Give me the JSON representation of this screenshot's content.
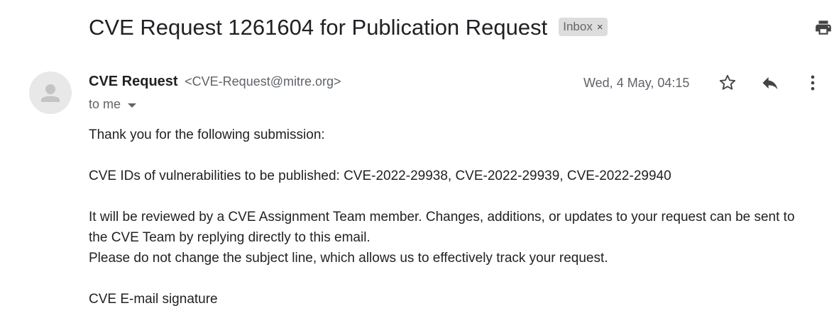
{
  "email": {
    "subject": "CVE Request 1261604 for Publication Request",
    "label": "Inbox",
    "label_close": "×",
    "sender_name": "CVE Request",
    "sender_email": "<CVE-Request@mitre.org>",
    "recipient": "to me",
    "timestamp": "Wed, 4 May, 04:15",
    "body": {
      "line1": "Thank you for the following submission:",
      "line2": "CVE IDs of vulnerabilities to be published: CVE-2022-29938, CVE-2022-29939, CVE-2022-29940",
      "line3": "It will be reviewed by a CVE Assignment Team member. Changes, additions, or updates to your request can be sent to",
      "line4": "the CVE Team by replying directly to this email.",
      "line5": "Please do not change the subject line, which allows us to effectively track your request.",
      "line6": "CVE E-mail signature"
    }
  },
  "icons": {
    "print": "print-icon",
    "avatar": "person-icon",
    "star": "star-icon",
    "reply": "reply-icon",
    "more": "more-vert-icon",
    "dropdown": "chevron-down-icon"
  },
  "colors": {
    "label_chip_bg": "#dddddd",
    "secondary_text": "#5f6368",
    "primary_text": "#202124"
  }
}
